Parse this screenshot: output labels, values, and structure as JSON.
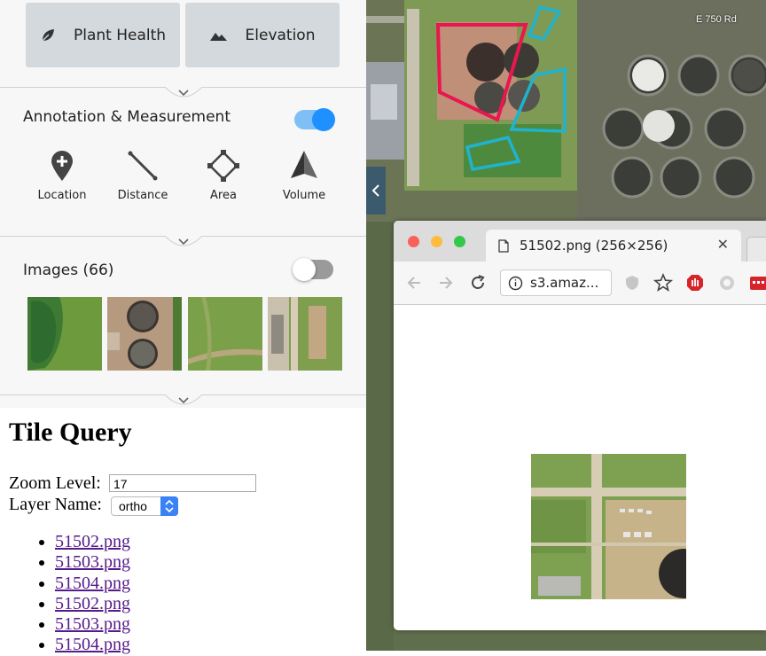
{
  "modes": {
    "plant_health": "Plant Health",
    "elevation": "Elevation"
  },
  "annotation": {
    "title": "Annotation & Measurement",
    "toggle_on": true,
    "tools": [
      {
        "label": "Location",
        "icon": "location-pin-icon"
      },
      {
        "label": "Distance",
        "icon": "distance-ruler-icon"
      },
      {
        "label": "Area",
        "icon": "area-polygon-icon"
      },
      {
        "label": "Volume",
        "icon": "volume-cone-icon"
      }
    ]
  },
  "images": {
    "title": "Images (66)",
    "toggle_on": false
  },
  "tile_query": {
    "title": "Tile Query",
    "zoom_label": "Zoom Level:",
    "zoom_value": "17",
    "layer_label": "Layer Name:",
    "layer_value": "ortho",
    "tiles": [
      "51502.png",
      "51503.png",
      "51504.png",
      "51502.png",
      "51503.png",
      "51504.png"
    ]
  },
  "map": {
    "road_label": "E 750 Rd"
  },
  "browser": {
    "tab_title": "51502.png (256×256)",
    "url": "s3.amaz..."
  },
  "colors": {
    "accent_blue": "#1e90ff",
    "polygon_red": "#e8174f",
    "polygon_cyan": "#1fb3cf",
    "link_visited": "#551a8b"
  }
}
